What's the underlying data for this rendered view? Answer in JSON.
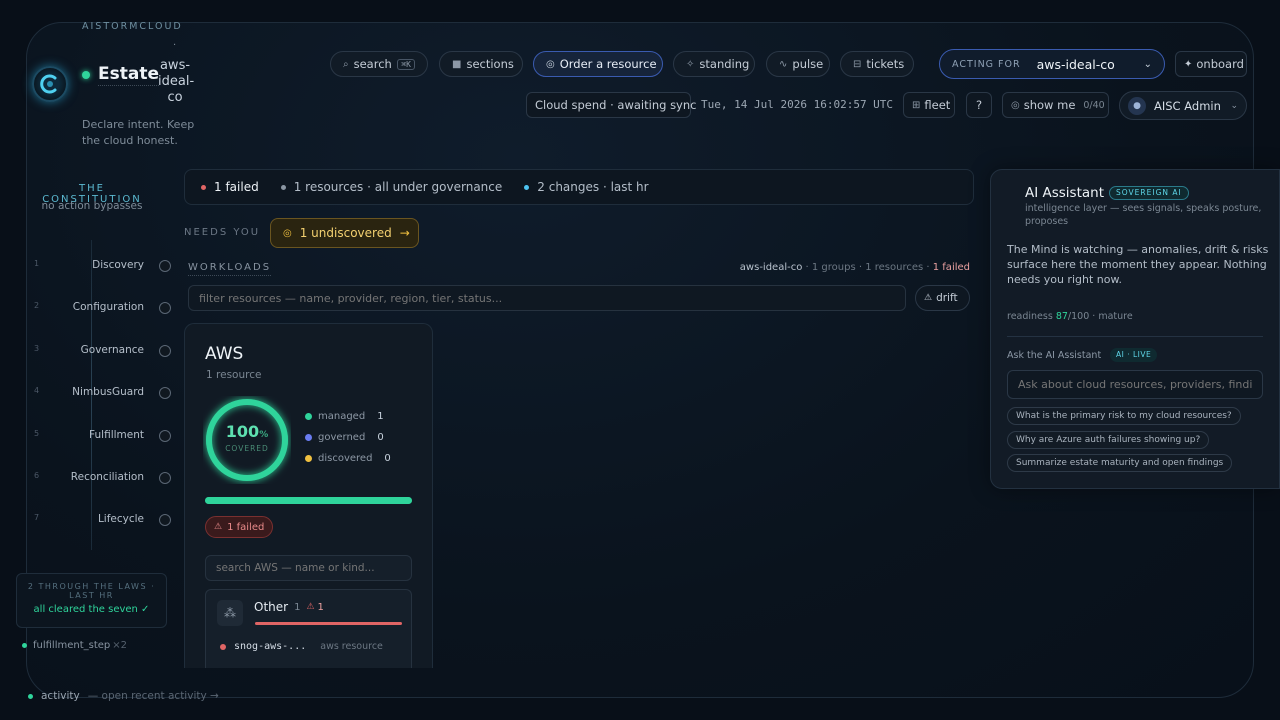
{
  "brand": {
    "org": "AISTORMCLOUD",
    "page": "Estate",
    "tenant_line1": "aws-",
    "tenant_line2": "ideal-",
    "tenant_line3": "co",
    "tagline_line1": "Declare intent. Keep",
    "tagline_line2": "the cloud honest."
  },
  "nav": {
    "search": "search",
    "search_kbd": "⌘K",
    "sections": "sections",
    "order": "Order a resource",
    "standing": "standing",
    "pulse": "pulse",
    "tickets": "tickets",
    "acting_label": "ACTING FOR",
    "acting_value": "aws-ideal-co",
    "onboard": "onboard"
  },
  "header2": {
    "cloud_spend": "Cloud spend · awaiting sync",
    "timestamp": "Tue, 14 Jul 2026 16:02:57 UTC",
    "fleet": "fleet",
    "help": "?",
    "show_me": "show me",
    "show_me_count": "0/40",
    "user": "AISC Admin"
  },
  "constitution": {
    "title": "THE CONSTITUTION",
    "subtitle": "no action bypasses",
    "steps": [
      {
        "num": "1",
        "label": "Discovery"
      },
      {
        "num": "2",
        "label": "Configuration"
      },
      {
        "num": "3",
        "label": "Governance"
      },
      {
        "num": "4",
        "label": "NimbusGuard"
      },
      {
        "num": "5",
        "label": "Fulfillment"
      },
      {
        "num": "6",
        "label": "Reconciliation"
      },
      {
        "num": "7",
        "label": "Lifecycle"
      }
    ],
    "laws_line1": "2 THROUGH THE LAWS ·",
    "laws_line2": "LAST HR",
    "laws_status": "all cleared the seven ✓",
    "event": "fulfillment_step",
    "event_count": "×2"
  },
  "footer": {
    "activity": "activity",
    "activity_link": "— open recent activity →"
  },
  "status": {
    "failed": "1 failed",
    "resources": "1 resources · all under governance",
    "changes": "2 changes · last hr"
  },
  "needs": {
    "label": "NEEDS YOU",
    "button": "1 undiscovered"
  },
  "workloads": {
    "label": "WORKLOADS",
    "tenant": "aws-ideal-co",
    "groups": " · 1 groups · 1 resources · ",
    "failed": "1 failed",
    "filter_placeholder": "filter resources — name, provider, region, tier, status...",
    "drift": "drift"
  },
  "provider": {
    "name": "AWS",
    "count": "1 resource",
    "coverage": "100",
    "coverage_unit": "%",
    "coverage_label": "COVERED",
    "legend": [
      {
        "label": "managed",
        "value": "1",
        "color": "#2fd49b"
      },
      {
        "label": "governed",
        "value": "0",
        "color": "#6a7cf0"
      },
      {
        "label": "discovered",
        "value": "0",
        "color": "#f0c040"
      }
    ],
    "failed_badge": "1 failed",
    "search_placeholder": "search AWS — name or kind...",
    "group": {
      "name": "Other",
      "count": "1",
      "alerts": "1"
    },
    "resource": {
      "name": "snog-aws-...",
      "kind": "aws resource"
    }
  },
  "assistant": {
    "title": "AI Assistant",
    "badge": "SOVEREIGN AI",
    "subtitle_line1": "intelligence layer — sees signals, speaks posture,",
    "subtitle_line2": "proposes",
    "message_line1": "The Mind is watching — anomalies, drift & risks",
    "message_line2": "surface here the moment they appear. Nothing",
    "message_line3": "needs you right now.",
    "readiness_label": "readiness ",
    "readiness_value": "87",
    "readiness_total": "/100 · mature",
    "ask_label": "Ask the AI Assistant",
    "live_badge": "AI · LIVE",
    "input_placeholder": "Ask about cloud resources, providers, findings...",
    "suggestions": [
      "What is the primary risk to my cloud resources?",
      "Why are Azure auth failures showing up?",
      "Summarize estate maturity and open findings"
    ]
  },
  "colors": {
    "accent": "#2fd49b",
    "danger": "#e06565",
    "warn": "#f0c040",
    "info": "#4dc3f0"
  }
}
